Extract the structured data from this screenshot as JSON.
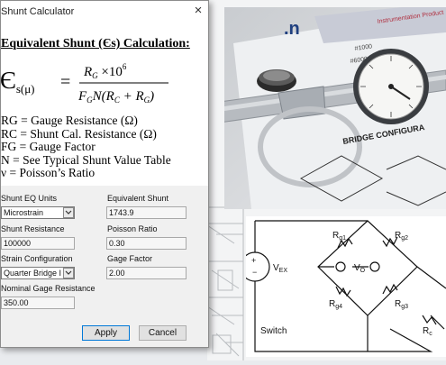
{
  "dialog": {
    "title": "Shunt Calculator",
    "close_glyph": "×",
    "heading": "Equivalent Shunt (Єs) Calculation:",
    "formula": {
      "lhs_symbol": "Є",
      "lhs_subscript": "s(μ)",
      "equals": "=",
      "numerator_1": "R",
      "numerator_1_sub": "G",
      "numerator_2": " ×10",
      "numerator_2_sup": "6",
      "denominator_1": "F",
      "denominator_1_sub": "G",
      "denominator_2": "N(R",
      "denominator_2_sub": "C",
      "denominator_3": " + R",
      "denominator_3_sub": "G",
      "denominator_4": ")"
    },
    "legend": [
      "RG = Gauge Resistance (Ω)",
      "RC = Shunt Cal. Resistance (Ω)",
      "FG = Gauge Factor",
      "N = See Typical Shunt Value Table",
      "ν = Poisson’s Ratio"
    ],
    "fields": {
      "shunt_eq_units": {
        "label": "Shunt EQ Units",
        "value": "Microstrain"
      },
      "equivalent_shunt": {
        "label": "Equivalent Shunt",
        "value": "1743.9"
      },
      "shunt_resistance": {
        "label": "Shunt Resistance",
        "value": "100000"
      },
      "poisson_ratio": {
        "label": "Poisson Ratio",
        "value": "0.30"
      },
      "strain_configuration": {
        "label": "Strain Configuration",
        "value": "Quarter Bridge I"
      },
      "gage_factor": {
        "label": "Gage Factor",
        "value": "2.00"
      },
      "nominal_gage_resistance": {
        "label": "Nominal Gage Resistance",
        "value": "350.00"
      }
    },
    "buttons": {
      "apply": "Apply",
      "cancel": "Cancel"
    }
  },
  "photo": {
    "logo_fragment": ".n",
    "bridge_config_text": "BRIDGE CONFIGURA",
    "header_fragment": "Instrumentation Product",
    "part_number_1": "#1000",
    "part_number_2": "#6000"
  },
  "schematic": {
    "vex_label": "V",
    "vex_sub": "EX",
    "plus": "+",
    "minus": "−",
    "vo_label": "V",
    "vo_sub": "O",
    "rg1": "R",
    "rg1_sub": "g1",
    "rg2": "R",
    "rg2_sub": "g2",
    "rg3": "R",
    "rg3_sub": "g3",
    "rg4": "R",
    "rg4_sub": "g4",
    "rc": "R",
    "rc_sub": "c",
    "switch_label": "Switch"
  },
  "colors": {
    "focus_blue": "#0078d7",
    "dialog_bg": "#f0f0f0"
  }
}
